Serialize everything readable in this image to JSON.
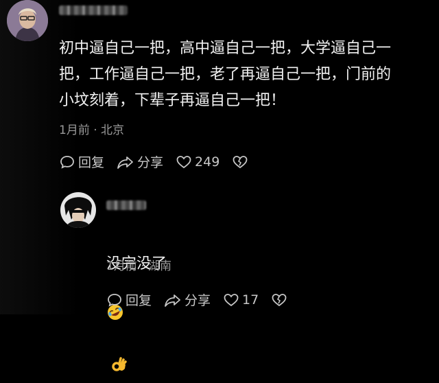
{
  "comments": [
    {
      "text": "初中逼自己一把，高中逼自己一把，大学逼自己一\n把，工作逼自己一把，老了再逼自己一把，门前的\n小坟刻着，下辈子再逼自己一把！",
      "time": "1月前",
      "dot": "·",
      "location": "北京",
      "reply_label": "回复",
      "share_label": "分享",
      "like_count": "249"
    },
    {
      "text": "没完没了",
      "time": "1月前",
      "dot": "·",
      "location": "湖南",
      "reply_label": "回复",
      "share_label": "分享",
      "like_count": "17"
    }
  ],
  "icons": {
    "reply": "speech-bubble-icon",
    "share": "share-arrow-icon",
    "like": "heart-icon",
    "dislike": "broken-heart-icon",
    "emoji1": "rolling-laughing-emoji",
    "emoji2": "ok-hand-emoji"
  },
  "colors": {
    "text": "#f2f2f2",
    "meta": "#9a9a9a",
    "background": "#000000"
  }
}
